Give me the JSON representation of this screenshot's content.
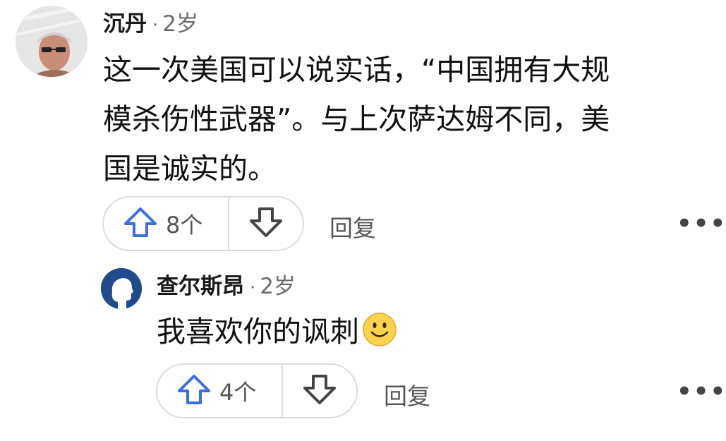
{
  "comment": {
    "author": "沉丹",
    "separator": "·",
    "age": "2岁",
    "text_lines": [
      "这一次美国可以说实话，“中国拥有大规",
      "模杀伤性武器”。与上次萨达姆不同，美",
      "国是诚实的。"
    ],
    "upvote_count": "8个",
    "reply_label": "回复",
    "more_label": "•••"
  },
  "reply": {
    "author": "查尔斯昂",
    "separator": "·",
    "age": "2岁",
    "text": "我喜欢你的讽刺",
    "emoji": "slightly-smiling-face-icon",
    "upvote_count": "4个",
    "reply_label": "回复",
    "more_label": "•••"
  },
  "colors": {
    "upvote_icon": "#3b6fe0",
    "downvote_icon": "#444444",
    "pill_border": "#dcdcdc",
    "reply_avatar_bg": "#1f4a8c"
  }
}
